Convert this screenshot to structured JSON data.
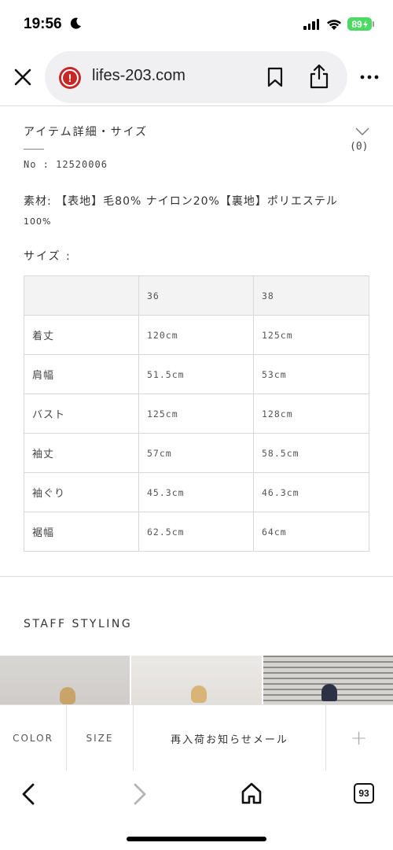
{
  "status_bar": {
    "time": "19:56",
    "battery": "89"
  },
  "browser": {
    "url": "lifes-203.com",
    "tabs_count": "93"
  },
  "detail": {
    "title": "アイテム詳細・サイズ",
    "count": "(0)",
    "item_no": "No : 12520006",
    "material_line1": "素材: 【表地】毛80% ナイロン20%【裏地】ポリエステル",
    "material_line2": "100%",
    "size_label": "サイズ :"
  },
  "size_table": {
    "headers": [
      "",
      "36",
      "38"
    ],
    "rows": [
      {
        "label": "着丈",
        "v36": "120cm",
        "v38": "125cm"
      },
      {
        "label": "肩幅",
        "v36": "51.5cm",
        "v38": "53cm"
      },
      {
        "label": "バスト",
        "v36": "125cm",
        "v38": "128cm"
      },
      {
        "label": "袖丈",
        "v36": "57cm",
        "v38": "58.5cm"
      },
      {
        "label": "袖ぐり",
        "v36": "45.3cm",
        "v38": "46.3cm"
      },
      {
        "label": "裾幅",
        "v36": "62.5cm",
        "v38": "64cm"
      }
    ]
  },
  "staff": {
    "title": "STAFF STYLING"
  },
  "action_bar": {
    "color_label": "COLOR",
    "size_label": "SIZE",
    "notify_label": "再入荷お知らせメール",
    "plus_label": "+"
  },
  "colors": {
    "battery_green": "#4cd964",
    "warning_red": "#c62828",
    "table_border": "#d8d8d8",
    "table_header_bg": "#f3f3f3"
  }
}
